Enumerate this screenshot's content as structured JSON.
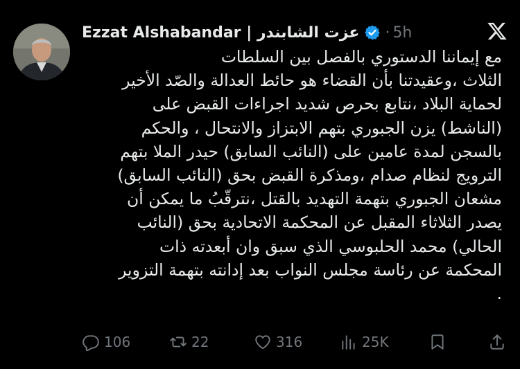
{
  "author": {
    "display_name": "Ezzat Alshabandar | عزت الشابندر",
    "separator": "·",
    "timestamp": "5h",
    "verified": true,
    "avatar_icon": "profile-photo"
  },
  "tweet": {
    "text": "مع إيماننا الدستوري بالفصل بين السلطات\nالثلاث ،وعقيدتنا بأن القضاء هو حائط العدالة والصّد الأخير\nلحماية البلاد ،نتابع بحرص شديد اجراءات القبض على\n(الناشط) يزن الجبوري بتهم الابتزاز والانتحال ، والحكم\nبالسجن لمدة عامين على (النائب السابق) حيدر الملا بتهم\nالترويج لنظام صدام ،ومذكرة القبض بحق (النائب السابق)\nمشعان الجبوري بتهمة التهديد بالقتل ،نترقّبُ ما يمكن أن\nيصدر الثلاثاء المقبل عن المحكمة الاتحادية بحق (النائب\nالحالي) محمد الحلبوسي الذي سبق وان أبعدته ذات\nالمحكمة عن رئاسة مجلس النواب بعد إدانته بتهمة التزوير\n."
  },
  "actions": {
    "replies": "106",
    "reposts": "22",
    "likes": "316",
    "views": "25K"
  },
  "colors": {
    "background": "#000000",
    "text": "#e7e9ea",
    "muted": "#71767b",
    "verified": "#1d9bf0"
  }
}
